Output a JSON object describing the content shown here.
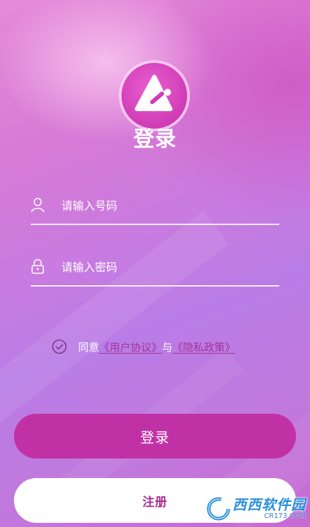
{
  "header": {
    "title": "登录"
  },
  "form": {
    "phone": {
      "placeholder": "请输入号码",
      "value": ""
    },
    "password": {
      "placeholder": "请输入密码",
      "value": ""
    }
  },
  "agreement": {
    "prefix": "同意",
    "user_agreement_link": "《用户协议》",
    "conjunction": "与",
    "privacy_policy_link": "《隐私政策》"
  },
  "actions": {
    "login_label": "登录",
    "register_label": "注册"
  },
  "watermark": {
    "main_text": "西西软件园",
    "sub_text": "CR173.COM"
  },
  "icons": {
    "logo": "app-logo-triangle-icon",
    "user": "user-icon",
    "lock": "lock-icon",
    "check": "check-circle-icon"
  },
  "colors": {
    "accent": "#c131a6",
    "link": "#a4329a",
    "register_text": "#a92c90"
  }
}
